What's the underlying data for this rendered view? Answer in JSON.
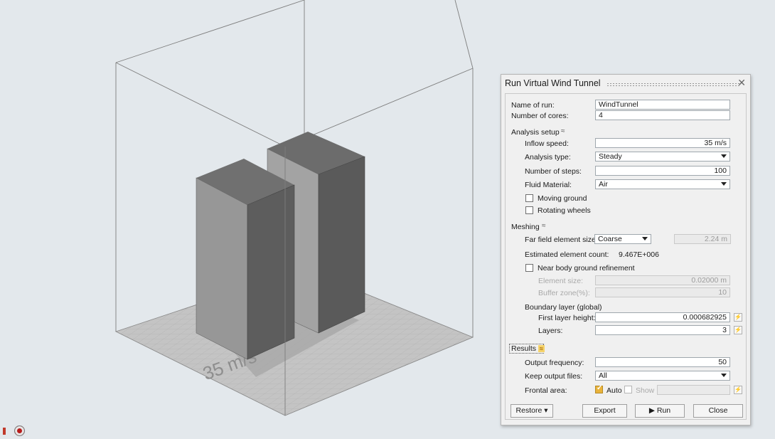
{
  "colors": {
    "background": "#e3e8ec",
    "box_front": "#989898",
    "box_side": "#5b5b5b",
    "box_top": "#6e6e6e",
    "ground": "#bfbfbf",
    "accent_check": "#e9b33a"
  },
  "viewport": {
    "ground_label": "35 m/s"
  },
  "dialog": {
    "title": "Run Virtual Wind Tunnel",
    "close_icon": "close-icon",
    "name_label": "Name of run:",
    "name_value": "WindTunnel",
    "cores_label": "Number of cores:",
    "cores_value": "4",
    "analysis": {
      "header": "Analysis setup",
      "inflow_label": "Inflow speed:",
      "inflow_value": "35 m/s",
      "type_label": "Analysis type:",
      "type_value": "Steady",
      "steps_label": "Number of steps:",
      "steps_value": "100",
      "fluid_label": "Fluid Material:",
      "fluid_value": "Air",
      "moving_ground": "Moving ground",
      "rotating_wheels": "Rotating wheels"
    },
    "meshing": {
      "header": "Meshing",
      "far_field_label": "Far field element size:",
      "far_field_value": "Coarse",
      "far_field_size": "2.24 m",
      "estimated_label": "Estimated element count:",
      "estimated_value": "9.467E+006",
      "near_body": "Near body ground refinement",
      "element_size_label": "Element size:",
      "element_size_value": "0.02000 m",
      "buffer_label": "Buffer zone(%):",
      "buffer_value": "10",
      "boundary_label": "Boundary layer (global)",
      "first_layer_label": "First layer height:",
      "first_layer_value": "0.000682925",
      "layers_label": "Layers:",
      "layers_value": "3"
    },
    "results": {
      "header": "Results",
      "output_freq_label": "Output frequency:",
      "output_freq_value": "50",
      "keep_label": "Keep output files:",
      "keep_value": "All",
      "frontal_label": "Frontal area:",
      "auto_label": "Auto",
      "show_label": "Show",
      "auto_checked": true
    },
    "buttons": {
      "restore": "Restore",
      "export": "Export",
      "run": "Run",
      "close": "Close"
    }
  }
}
